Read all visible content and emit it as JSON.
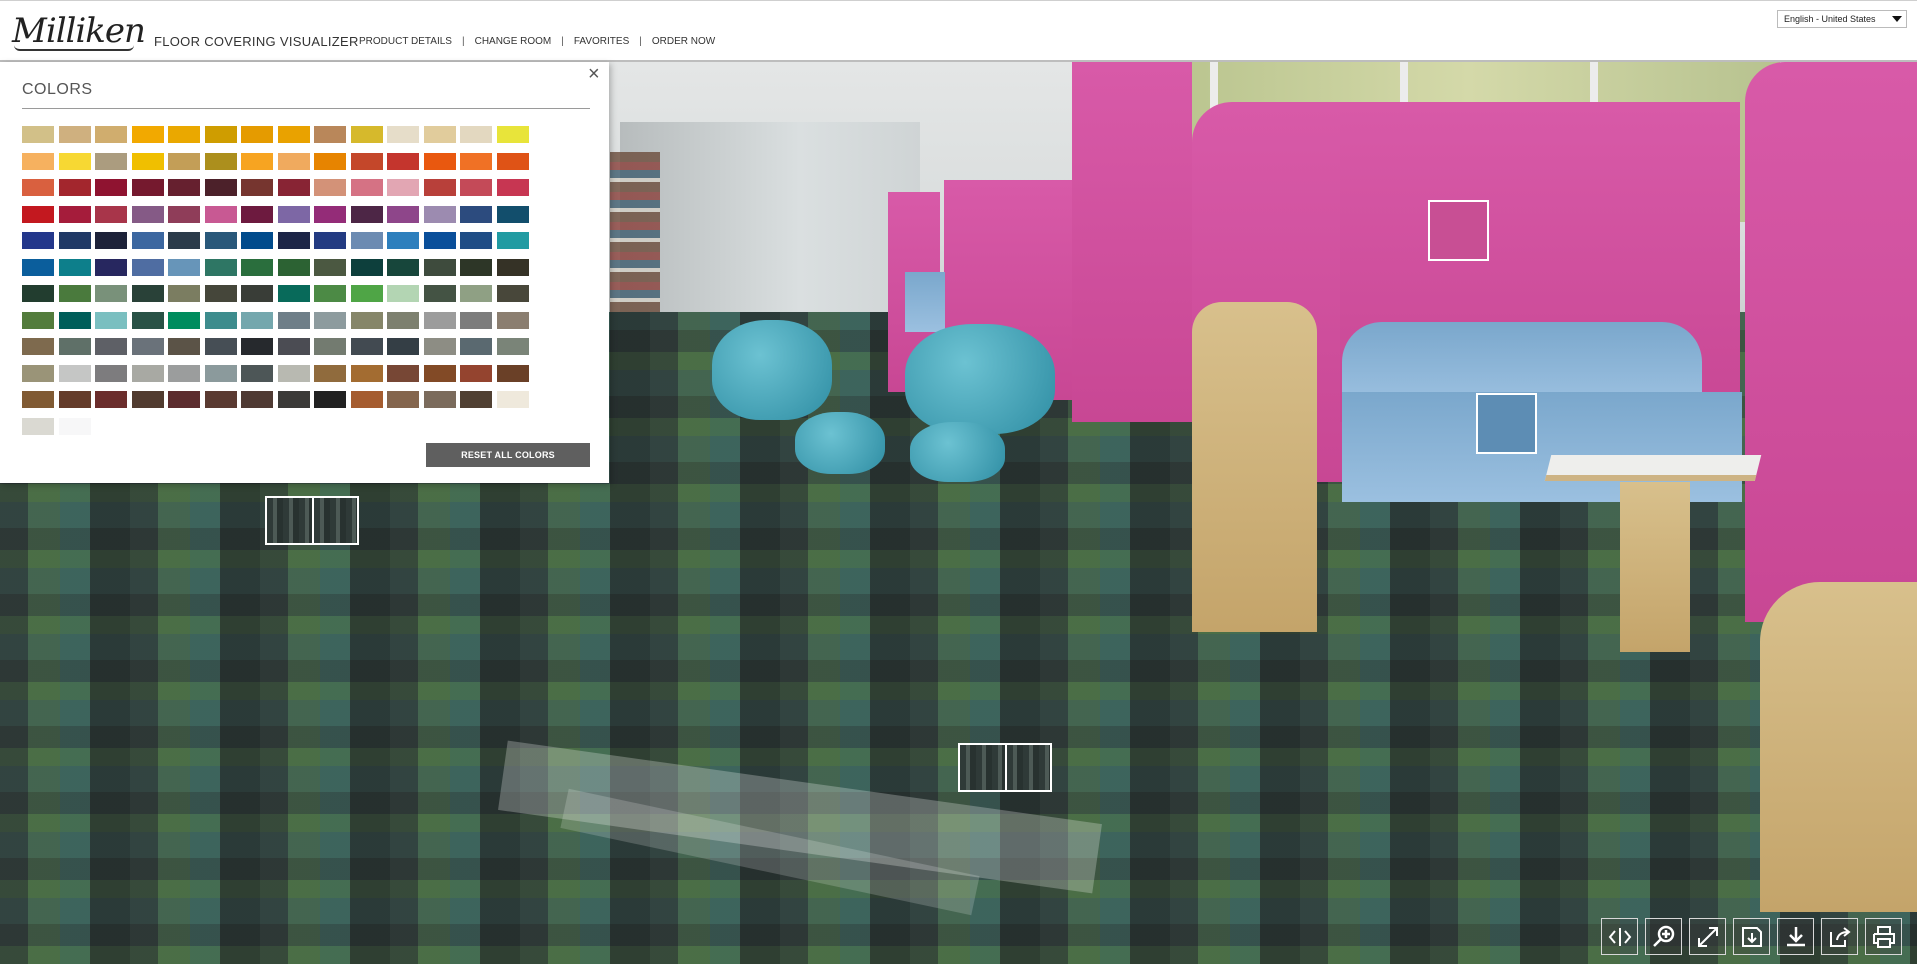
{
  "header": {
    "logo_text": "Milliken",
    "app_title": "FLOOR COVERING VISUALIZER",
    "nav": [
      {
        "label": "PRODUCT DETAILS"
      },
      {
        "label": "CHANGE ROOM"
      },
      {
        "label": "FAVORITES"
      },
      {
        "label": "ORDER NOW"
      }
    ],
    "nav_separator": "|",
    "language": "English - United States"
  },
  "colors_panel": {
    "title": "COLORS",
    "close_label": "×",
    "reset_label": "RESET ALL COLORS",
    "swatches": [
      "#d2c088",
      "#cfb07f",
      "#d0ad6e",
      "#f2a900",
      "#eaa800",
      "#cf9d00",
      "#e59b00",
      "#e9a200",
      "#b9875a",
      "#d6b92c",
      "#e6ddc9",
      "#e1cc9c",
      "#e3d8c0",
      "#e8e43a",
      "#f6b15f",
      "#f7d833",
      "#ab9c7f",
      "#f0bf00",
      "#c39e57",
      "#ac8f1d",
      "#f7a421",
      "#f0aa5e",
      "#e78400",
      "#c4472a",
      "#c4352d",
      "#e9580f",
      "#f07125",
      "#df5316",
      "#d9603f",
      "#a3262d",
      "#8f1330",
      "#75192e",
      "#66202f",
      "#4c212a",
      "#76352f",
      "#882434",
      "#d39278",
      "#d57284",
      "#e2a6b3",
      "#b8403a",
      "#c44a58",
      "#c73652",
      "#c3181f",
      "#a51c3b",
      "#a8354a",
      "#855a86",
      "#8f3d59",
      "#c85993",
      "#6d1a3f",
      "#7d67a5",
      "#942c78",
      "#4d2646",
      "#8e468a",
      "#9c8bb0",
      "#2c4b7e",
      "#124e6c",
      "#23378b",
      "#203966",
      "#1d2239",
      "#3c67a0",
      "#2b3b4a",
      "#29587a",
      "#014b8c",
      "#1c2547",
      "#233b82",
      "#6c8bb2",
      "#2d7fbd",
      "#0a4f9a",
      "#1f4d86",
      "#219ba2",
      "#0b5e9c",
      "#0d7f8b",
      "#27275f",
      "#4f6da2",
      "#6795b9",
      "#2e7664",
      "#2a6e3d",
      "#2c6233",
      "#4b5841",
      "#0d3f3c",
      "#17463b",
      "#3e4b3d",
      "#2d3627",
      "#353226",
      "#223d2f",
      "#4a7a3d",
      "#79917a",
      "#294138",
      "#7b7d61",
      "#45463a",
      "#393d37",
      "#086a5a",
      "#4c8a45",
      "#4fa546",
      "#b3d5b3",
      "#445344",
      "#8fa084",
      "#48473a",
      "#537c3c",
      "#005e5a",
      "#7abfc0",
      "#295246",
      "#008c5e",
      "#3d8c8d",
      "#74a7ad",
      "#6e7e88",
      "#8d9b9e",
      "#868669",
      "#7d806f",
      "#9c9c9c",
      "#7c7c7c",
      "#8b7e70",
      "#7e6a4e",
      "#5f7068",
      "#5e6066",
      "#6a727a",
      "#5b5347",
      "#464e55",
      "#26292d",
      "#4b4c53",
      "#737b70",
      "#424a51",
      "#343e45",
      "#8d8d84",
      "#5a6970",
      "#7a8478",
      "#9a9478",
      "#c5c6c5",
      "#7d7c7e",
      "#a8a9a3",
      "#9b9d9d",
      "#8b9a9c",
      "#4d5657",
      "#b8b9b1",
      "#906b3d",
      "#a36c31",
      "#774735",
      "#824a26",
      "#94442f",
      "#6a4027",
      "#805a33",
      "#643c2a",
      "#6b2d2c",
      "#513b2f",
      "#5c2c2e",
      "#5a3a31",
      "#4f3a33",
      "#3b3a38",
      "#212121",
      "#a55c2f",
      "#84654d",
      "#7b6b5c",
      "#504032",
      "#efe9dc",
      "#dad9d2",
      "#f7f7f8"
    ]
  },
  "hotspots": {
    "pod_wall_color": "#c84f94",
    "seat_color": "#5d8db4"
  },
  "toolbar": [
    {
      "name": "compare-icon"
    },
    {
      "name": "zoom-in-icon"
    },
    {
      "name": "fullscreen-icon"
    },
    {
      "name": "save-icon"
    },
    {
      "name": "download-icon"
    },
    {
      "name": "share-icon"
    },
    {
      "name": "print-icon"
    }
  ]
}
